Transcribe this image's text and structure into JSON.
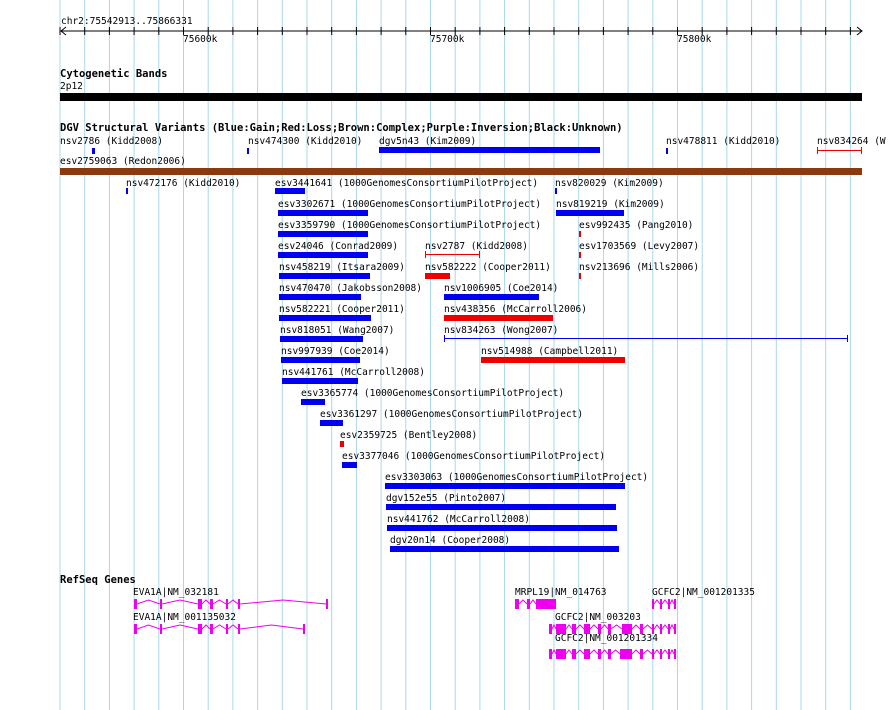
{
  "position_label": "chr2:75542913..75866331",
  "ruler": {
    "ticks": [
      "75600k",
      "75700k",
      "75800k"
    ]
  },
  "cyto": {
    "title": "Cytogenetic Bands",
    "band": "2p12"
  },
  "dgv": {
    "title": "DGV Structural Variants (Blue:Gain;Red:Loss;Brown:Complex;Purple:Inversion;Black:Unknown)",
    "colors": {
      "gain": "#0000ee",
      "loss": "#ee0000",
      "complex": "#8b3a10"
    },
    "variants": [
      {
        "label": "nsv2786 (Kidd2008)",
        "type": "gain",
        "style": "thin"
      },
      {
        "label": "nsv474300 (Kidd2010)",
        "type": "gain",
        "style": "thin"
      },
      {
        "label": "dgv5n43 (Kim2009)",
        "type": "gain",
        "style": "thick"
      },
      {
        "label": "nsv478811 (Kidd2010)",
        "type": "gain",
        "style": "thin"
      },
      {
        "label": "nsv834264 (W",
        "type": "loss",
        "style": "thin"
      },
      {
        "label": "esv2759063 (Redon2006)",
        "type": "complex",
        "style": "thick"
      },
      {
        "label": "nsv472176 (Kidd2010)",
        "type": "gain",
        "style": "thin"
      },
      {
        "label": "esv3441641 (1000GenomesConsortiumPilotProject)",
        "type": "gain",
        "style": "thick"
      },
      {
        "label": "nsv820029 (Kim2009)",
        "type": "gain",
        "style": "thin"
      },
      {
        "label": "esv3302671 (1000GenomesConsortiumPilotProject)",
        "type": "gain",
        "style": "thick"
      },
      {
        "label": "nsv819219 (Kim2009)",
        "type": "gain",
        "style": "thick"
      },
      {
        "label": "esv3359790 (1000GenomesConsortiumPilotProject)",
        "type": "gain",
        "style": "thick"
      },
      {
        "label": "esv992435 (Pang2010)",
        "type": "loss",
        "style": "thin"
      },
      {
        "label": "esv24046 (Conrad2009)",
        "type": "gain",
        "style": "thick"
      },
      {
        "label": "nsv2787 (Kidd2008)",
        "type": "loss",
        "style": "thin"
      },
      {
        "label": "esv1703569 (Levy2007)",
        "type": "loss",
        "style": "thin"
      },
      {
        "label": "nsv458219 (Itsara2009)",
        "type": "gain",
        "style": "thick"
      },
      {
        "label": "nsv582222 (Cooper2011)",
        "type": "loss",
        "style": "thick"
      },
      {
        "label": "nsv213696 (Mills2006)",
        "type": "loss",
        "style": "thin"
      },
      {
        "label": "nsv470470 (Jakobsson2008)",
        "type": "gain",
        "style": "thick"
      },
      {
        "label": "nsv1006905 (Coe2014)",
        "type": "gain",
        "style": "thick"
      },
      {
        "label": "nsv582221 (Cooper2011)",
        "type": "gain",
        "style": "thick"
      },
      {
        "label": "nsv438356 (McCarroll2006)",
        "type": "loss",
        "style": "thick"
      },
      {
        "label": "nsv818051 (Wang2007)",
        "type": "gain",
        "style": "thick"
      },
      {
        "label": "nsv834263 (Wong2007)",
        "type": "gain",
        "style": "thin"
      },
      {
        "label": "nsv997939 (Coe2014)",
        "type": "gain",
        "style": "thick"
      },
      {
        "label": "nsv514988 (Campbell2011)",
        "type": "loss",
        "style": "thick"
      },
      {
        "label": "nsv441761 (McCarroll2008)",
        "type": "gain",
        "style": "thick"
      },
      {
        "label": "esv3365774 (1000GenomesConsortiumPilotProject)",
        "type": "gain",
        "style": "thick"
      },
      {
        "label": "esv3361297 (1000GenomesConsortiumPilotProject)",
        "type": "gain",
        "style": "thick"
      },
      {
        "label": "esv2359725 (Bentley2008)",
        "type": "loss",
        "style": "thick"
      },
      {
        "label": "esv3377046 (1000GenomesConsortiumPilotProject)",
        "type": "gain",
        "style": "thick"
      },
      {
        "label": "esv3303063 (1000GenomesConsortiumPilotProject)",
        "type": "gain",
        "style": "thick"
      },
      {
        "label": "dgv152e55 (Pinto2007)",
        "type": "gain",
        "style": "thick"
      },
      {
        "label": "nsv441762 (McCarroll2008)",
        "type": "gain",
        "style": "thick"
      },
      {
        "label": "dgv20n14 (Cooper2008)",
        "type": "gain",
        "style": "thick"
      }
    ]
  },
  "refseq": {
    "title": "RefSeq Genes",
    "color": "#ee00ee",
    "genes": [
      {
        "label": "EVA1A|NM_032181"
      },
      {
        "label": "EVA1A|NM_001135032"
      },
      {
        "label": "MRPL19|NM_014763"
      },
      {
        "label": "GCFC2|NM_001201335"
      },
      {
        "label": "GCFC2|NM_003203"
      },
      {
        "label": "GCFC2|NM_001201334"
      }
    ]
  }
}
